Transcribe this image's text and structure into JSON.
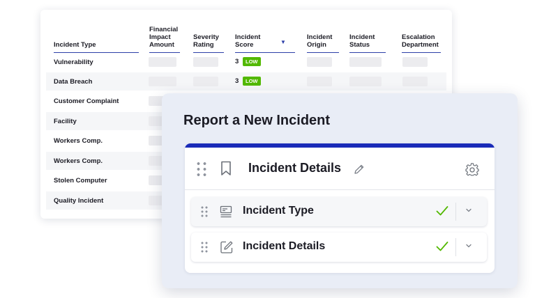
{
  "table": {
    "headers": [
      {
        "key": "type",
        "label": "Incident Type"
      },
      {
        "key": "impact",
        "label": "Financial Impact Amount"
      },
      {
        "key": "severity",
        "label": "Severity Rating"
      },
      {
        "key": "score",
        "label": "Incident Score"
      },
      {
        "key": "origin",
        "label": "Incident Origin"
      },
      {
        "key": "status",
        "label": "Incident Status"
      },
      {
        "key": "escalation",
        "label": "Escalation Department"
      }
    ],
    "rows": [
      {
        "type": "Vulnerability",
        "score": "3",
        "badge": "LOW"
      },
      {
        "type": "Data Breach",
        "score": "3",
        "badge": "LOW"
      },
      {
        "type": "Customer Complaint"
      },
      {
        "type": "Facility"
      },
      {
        "type": "Workers Comp."
      },
      {
        "type": "Workers Comp."
      },
      {
        "type": "Stolen Computer"
      },
      {
        "type": "Quality Incident"
      }
    ],
    "sort_icon": "sort-down-icon"
  },
  "form": {
    "title": "Report a New Incident",
    "section": {
      "title": "Incident Details",
      "icons": [
        "drag-handle-icon",
        "bookmark-icon",
        "pencil-icon",
        "gear-icon"
      ]
    },
    "subsections": [
      {
        "label": "Incident Type",
        "icon": "list-icon",
        "status": "check-icon"
      },
      {
        "label": "Incident Details",
        "icon": "edit-icon",
        "status": "check-icon"
      }
    ]
  },
  "colors": {
    "accent": "#1a2bb8",
    "underline": "#2b3ea8",
    "low_badge": "#52b800",
    "check": "#52b800",
    "card_bg": "#e9edf6"
  }
}
